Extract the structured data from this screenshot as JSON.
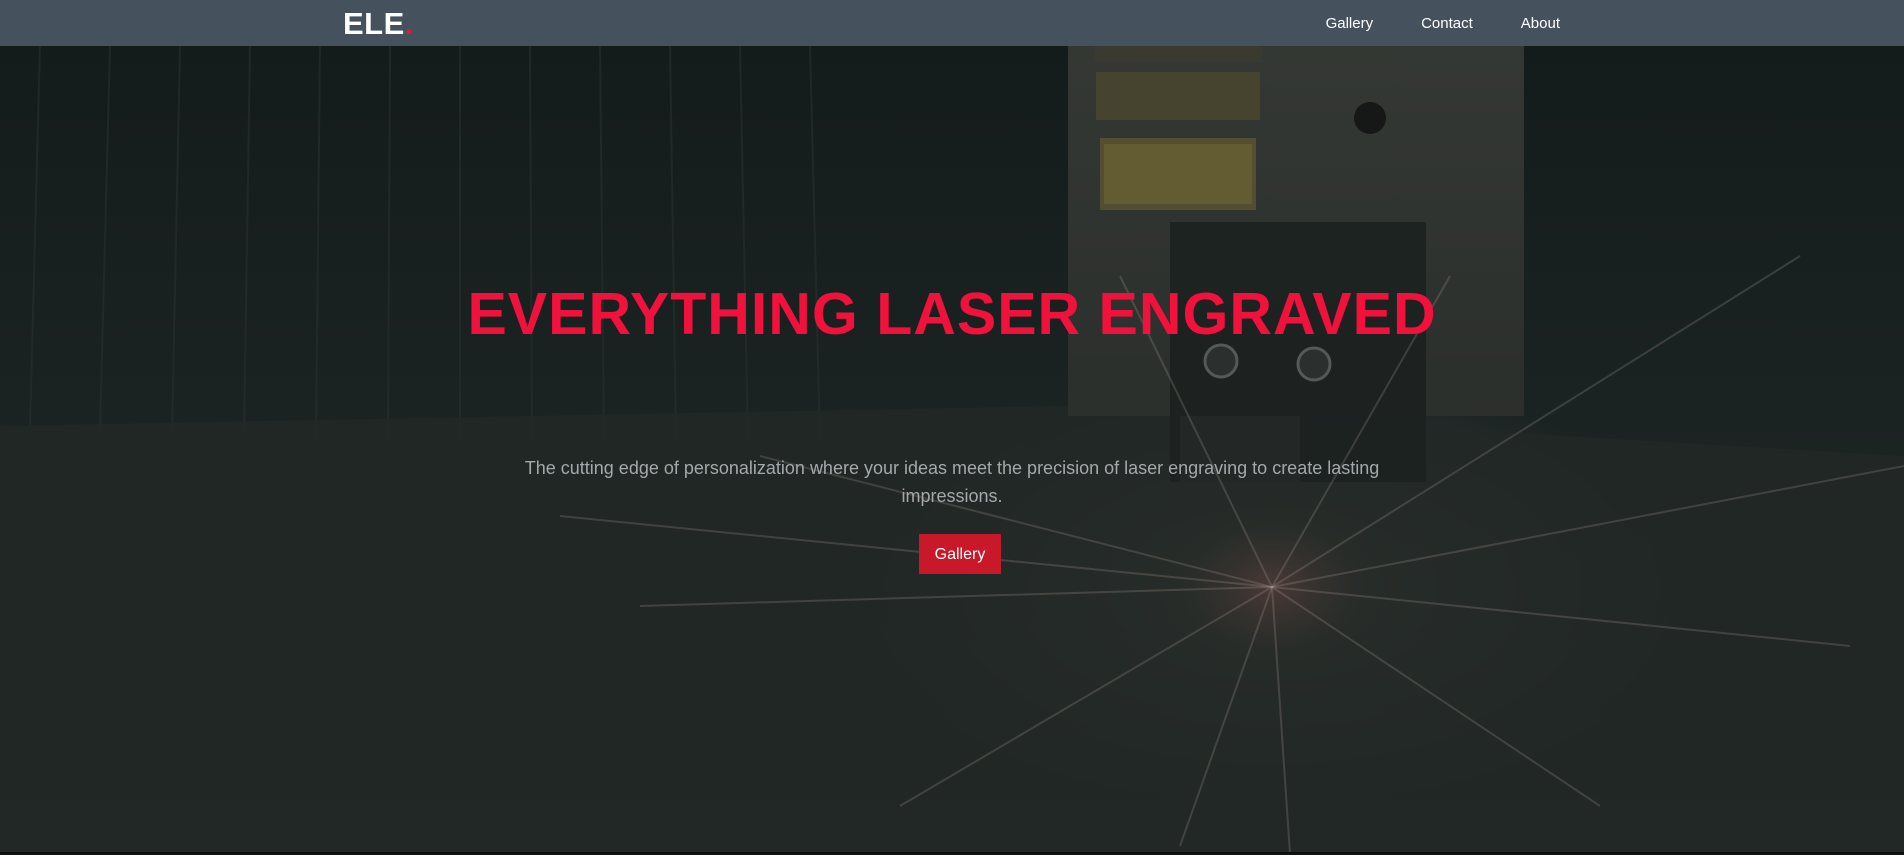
{
  "nav": {
    "brand": "ELE",
    "brand_dot": ".",
    "links": [
      "Gallery",
      "Contact",
      "About"
    ]
  },
  "hero": {
    "title": "EVERYTHING LASER ENGRAVED",
    "subtitle": "The cutting edge of personalization where your ideas meet the precision of laser engraving to create lasting impressions.",
    "button_label": "Gallery",
    "background_image_description": "laser engraving machine with bright spark"
  },
  "colors": {
    "navbar": "#45525e",
    "accent": "#f0113c",
    "button": "#c8182a",
    "subtitle": "#a4a8aa"
  }
}
